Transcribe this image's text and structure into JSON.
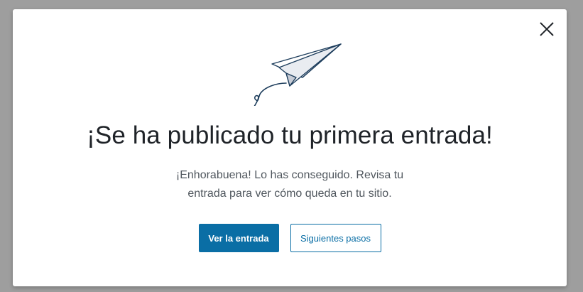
{
  "modal": {
    "title": "¡Se ha publicado tu primera entrada!",
    "message_line1": "¡Enhorabuena! Lo has conseguido. Revisa tu",
    "message_line2": "entrada para ver cómo queda en tu sitio.",
    "close_icon": "close-icon",
    "illustration_icon": "paper-plane-icon",
    "primary_button_label": "Ver la entrada",
    "secondary_button_label": "Siguientes pasos"
  },
  "colors": {
    "overlay": "#9e9e9e",
    "modal_bg": "#ffffff",
    "title": "#1f2328",
    "text": "#50575e",
    "accent": "#0a6ea5",
    "illustration_stroke": "#1d3d5c"
  }
}
